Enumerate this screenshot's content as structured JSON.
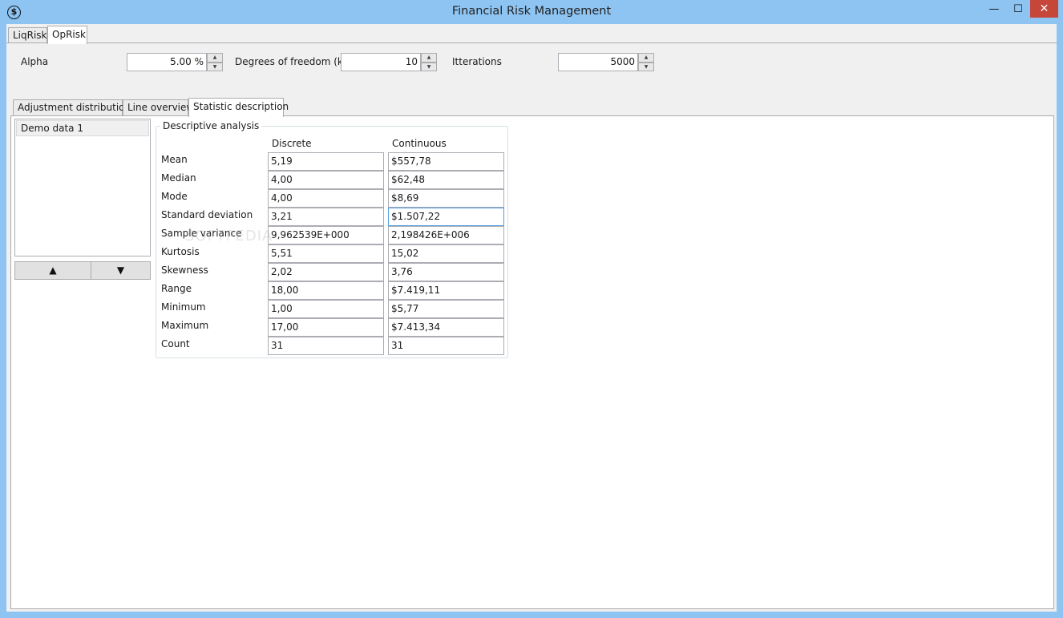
{
  "window": {
    "title": "Financial Risk Management",
    "app_icon": "$",
    "minimize_glyph": "—",
    "maximize_glyph": "☐",
    "close_glyph": "✕"
  },
  "top_tabs": [
    {
      "label": "LiqRisk",
      "active": false
    },
    {
      "label": "OpRisk",
      "active": true
    }
  ],
  "params": {
    "alpha": {
      "label": "Alpha",
      "value": "5.00 %"
    },
    "dof": {
      "label": "Degrees of freedom (k)",
      "value": "10"
    },
    "iterations": {
      "label": "Itterations",
      "value": "5000"
    }
  },
  "sub_tabs": [
    {
      "label": "Adjustment distribution",
      "active": false
    },
    {
      "label": "Line overview",
      "active": false
    },
    {
      "label": "Statistic description",
      "active": true
    }
  ],
  "list": {
    "items": [
      "Demo data 1"
    ],
    "up_glyph": "▲",
    "down_glyph": "▼"
  },
  "analysis": {
    "title": "Descriptive analysis",
    "col_discrete": "Discrete",
    "col_continuous": "Continuous",
    "rows": [
      {
        "label": "Mean",
        "discrete": "5,19",
        "continuous": "$557,78"
      },
      {
        "label": "Median",
        "discrete": "4,00",
        "continuous": "$62,48"
      },
      {
        "label": "Mode",
        "discrete": "4,00",
        "continuous": "$8,69"
      },
      {
        "label": "Standard deviation",
        "discrete": "3,21",
        "continuous": "$1.507,22"
      },
      {
        "label": "Sample variance",
        "discrete": "9,962539E+000",
        "continuous": "2,198426E+006"
      },
      {
        "label": "Kurtosis",
        "discrete": "5,51",
        "continuous": "15,02"
      },
      {
        "label": "Skewness",
        "discrete": "2,02",
        "continuous": "3,76"
      },
      {
        "label": "Range",
        "discrete": "18,00",
        "continuous": "$7.419,11"
      },
      {
        "label": "Minimum",
        "discrete": "1,00",
        "continuous": "$5,77"
      },
      {
        "label": "Maximum",
        "discrete": "17,00",
        "continuous": "$7.413,34"
      },
      {
        "label": "Count",
        "discrete": "31",
        "continuous": "31"
      }
    ]
  },
  "watermark": "SOFTPEDIA"
}
